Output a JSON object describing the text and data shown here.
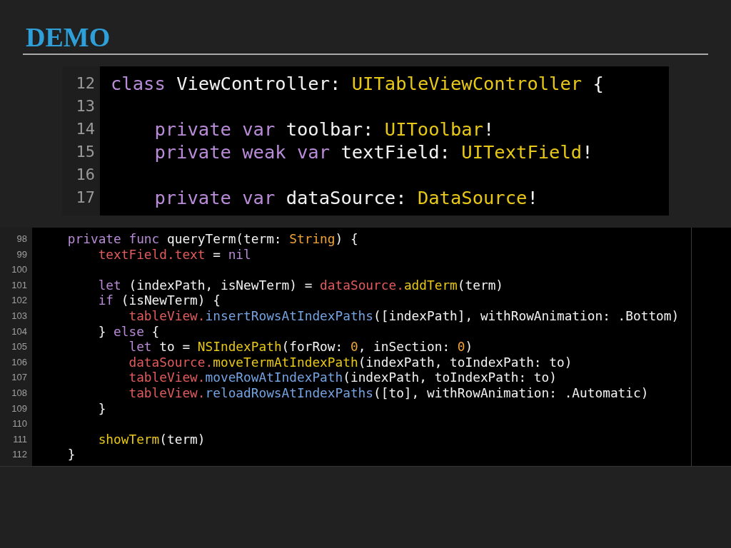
{
  "slide": {
    "title": "DEMO"
  },
  "snippets": [
    {
      "kind": "enlarged",
      "lines": [
        {
          "number": "12",
          "tokens": [
            {
              "kind": "keyword",
              "text": "class "
            },
            {
              "kind": "plain",
              "text": "ViewController: "
            },
            {
              "kind": "type",
              "text": "UITableViewController"
            },
            {
              "kind": "plain",
              "text": " {"
            }
          ]
        },
        {
          "number": "13"
        },
        {
          "number": "14",
          "tokens": [
            {
              "kind": "keyword",
              "text": "    private var "
            },
            {
              "kind": "plain",
              "text": "toolbar: "
            },
            {
              "kind": "type",
              "text": "UIToolbar"
            },
            {
              "kind": "plain",
              "text": "!"
            }
          ]
        },
        {
          "number": "15",
          "tokens": [
            {
              "kind": "keyword",
              "text": "    private weak var "
            },
            {
              "kind": "plain",
              "text": "textField: "
            },
            {
              "kind": "type",
              "text": "UITextField"
            },
            {
              "kind": "plain",
              "text": "!"
            }
          ]
        },
        {
          "number": "16"
        },
        {
          "number": "17",
          "tokens": [
            {
              "kind": "keyword",
              "text": "    private var "
            },
            {
              "kind": "plain",
              "text": "dataSource: "
            },
            {
              "kind": "type",
              "text": "DataSource"
            },
            {
              "kind": "plain",
              "text": "!"
            }
          ]
        }
      ]
    },
    {
      "kind": "editor",
      "lines": [
        {
          "number": "98",
          "tokens": [
            {
              "kind": "keyword",
              "text": "    private func "
            },
            {
              "kind": "plain",
              "text": "queryTerm(term: "
            },
            {
              "kind": "builtin",
              "text": "String"
            },
            {
              "kind": "plain",
              "text": ") {"
            }
          ]
        },
        {
          "number": "99",
          "tokens": [
            {
              "kind": "member",
              "text": "        textField.text"
            },
            {
              "kind": "plain",
              "text": " = "
            },
            {
              "kind": "keyword",
              "text": "nil"
            }
          ]
        },
        {
          "number": "100"
        },
        {
          "number": "101",
          "tokens": [
            {
              "kind": "keyword",
              "text": "        let "
            },
            {
              "kind": "plain",
              "text": "(indexPath, isNewTerm) = "
            },
            {
              "kind": "member",
              "text": "dataSource."
            },
            {
              "kind": "type",
              "text": "addTerm"
            },
            {
              "kind": "plain",
              "text": "(term)"
            }
          ]
        },
        {
          "number": "102",
          "tokens": [
            {
              "kind": "keyword",
              "text": "        if "
            },
            {
              "kind": "plain",
              "text": "(isNewTerm) {"
            }
          ]
        },
        {
          "number": "103",
          "tokens": [
            {
              "kind": "member",
              "text": "            tableView."
            },
            {
              "kind": "api",
              "text": "insertRowsAtIndexPaths"
            },
            {
              "kind": "plain",
              "text": "([indexPath], withRowAnimation: .Bottom)"
            }
          ]
        },
        {
          "number": "104",
          "tokens": [
            {
              "kind": "plain",
              "text": "        } "
            },
            {
              "kind": "keyword",
              "text": "else"
            },
            {
              "kind": "plain",
              "text": " {"
            }
          ]
        },
        {
          "number": "105",
          "tokens": [
            {
              "kind": "keyword",
              "text": "            let "
            },
            {
              "kind": "plain",
              "text": "to = "
            },
            {
              "kind": "type",
              "text": "NSIndexPath"
            },
            {
              "kind": "plain",
              "text": "(forRow: "
            },
            {
              "kind": "number",
              "text": "0"
            },
            {
              "kind": "plain",
              "text": ", inSection: "
            },
            {
              "kind": "number",
              "text": "0"
            },
            {
              "kind": "plain",
              "text": ")"
            }
          ]
        },
        {
          "number": "106",
          "tokens": [
            {
              "kind": "member",
              "text": "            dataSource."
            },
            {
              "kind": "type",
              "text": "moveTermAtIndexPath"
            },
            {
              "kind": "plain",
              "text": "(indexPath, toIndexPath: to)"
            }
          ]
        },
        {
          "number": "107",
          "tokens": [
            {
              "kind": "member",
              "text": "            tableView."
            },
            {
              "kind": "api",
              "text": "moveRowAtIndexPath"
            },
            {
              "kind": "plain",
              "text": "(indexPath, toIndexPath: to)"
            }
          ]
        },
        {
          "number": "108",
          "tokens": [
            {
              "kind": "member",
              "text": "            tableView."
            },
            {
              "kind": "api",
              "text": "reloadRowsAtIndexPaths"
            },
            {
              "kind": "plain",
              "text": "([to], withRowAnimation: .Automatic)"
            }
          ]
        },
        {
          "number": "109",
          "tokens": [
            {
              "kind": "plain",
              "text": "        }"
            }
          ]
        },
        {
          "number": "110"
        },
        {
          "number": "111",
          "tokens": [
            {
              "kind": "type",
              "text": "        showTerm"
            },
            {
              "kind": "plain",
              "text": "(term)"
            }
          ]
        },
        {
          "number": "112",
          "tokens": [
            {
              "kind": "plain",
              "text": "    }"
            }
          ]
        }
      ]
    }
  ]
}
